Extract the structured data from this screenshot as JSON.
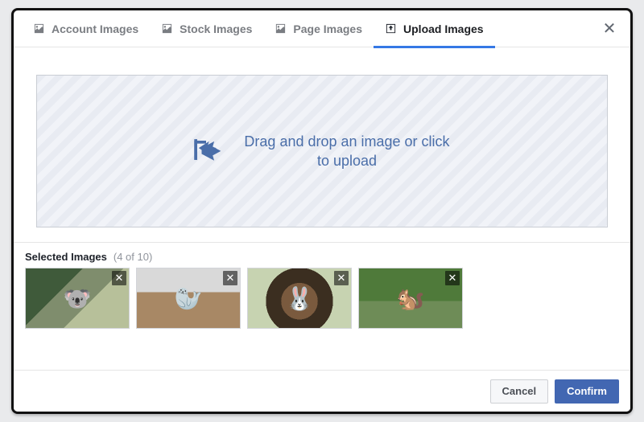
{
  "tabs": [
    {
      "label": "Account Images"
    },
    {
      "label": "Stock Images"
    },
    {
      "label": "Page Images"
    },
    {
      "label": "Upload Images"
    }
  ],
  "active_tab_index": 3,
  "close_glyph": "✕",
  "dropzone": {
    "text": "Drag and drop an image or click to upload"
  },
  "selected": {
    "label": "Selected Images",
    "count_text": "(4 of 10)",
    "remove_glyph": "✕",
    "thumbs": [
      {
        "alt": "koala",
        "emoji": "🐨"
      },
      {
        "alt": "walrus",
        "emoji": "🦭"
      },
      {
        "alt": "rabbit",
        "emoji": "🐰"
      },
      {
        "alt": "squirrel",
        "emoji": "🐿️"
      }
    ]
  },
  "footer": {
    "cancel": "Cancel",
    "confirm": "Confirm"
  }
}
